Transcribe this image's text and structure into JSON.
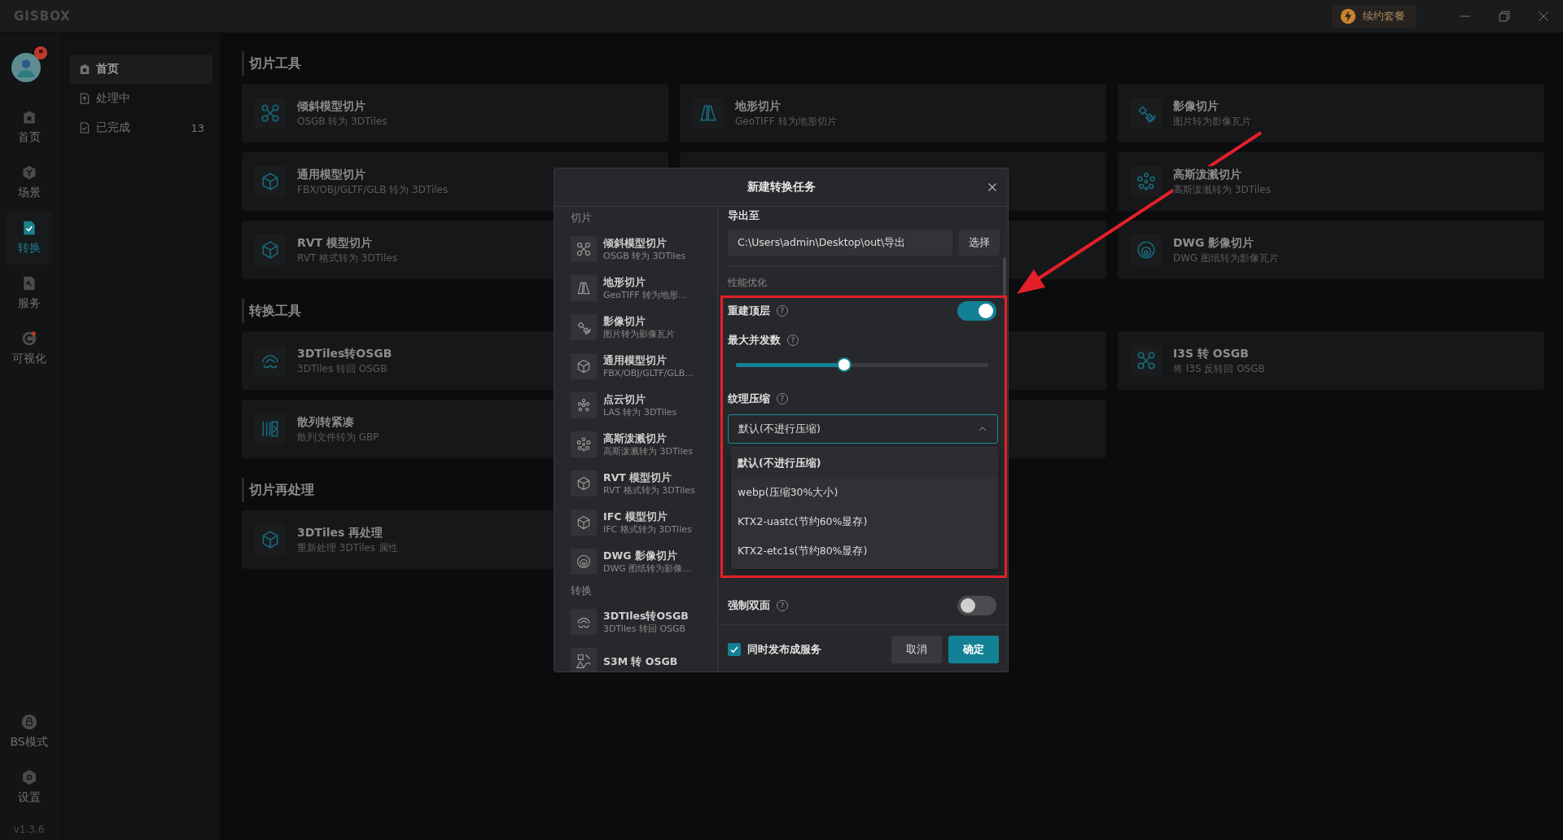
{
  "titlebar": {
    "logo": "GISBOX",
    "renew_button": "续约套餐"
  },
  "nav_rail": {
    "items": [
      {
        "label": "首页",
        "kind": "home",
        "selected": false
      },
      {
        "label": "场景",
        "kind": "scene",
        "selected": false
      },
      {
        "label": "转换",
        "kind": "convert",
        "selected": true
      },
      {
        "label": "服务",
        "kind": "service",
        "selected": false
      },
      {
        "label": "可视化",
        "kind": "visual",
        "selected": false
      }
    ],
    "bottom_items": [
      {
        "label": "BS模式",
        "kind": "lock"
      },
      {
        "label": "设置",
        "kind": "settings"
      }
    ],
    "version": "v1.3.6"
  },
  "task_menu": {
    "items": [
      {
        "label": "首页",
        "kind": "home",
        "selected": true
      },
      {
        "label": "处理中",
        "kind": "upload",
        "selected": false
      },
      {
        "label": "已完成",
        "kind": "done",
        "count": "13",
        "selected": false
      }
    ]
  },
  "sections": [
    {
      "title": "切片工具",
      "cards": [
        {
          "kind": "oblique",
          "title": "倾斜模型切片",
          "description": "OSGB 转为 3DTiles"
        },
        {
          "kind": "terrain",
          "title": "地形切片",
          "description": "GeoTIFF 转为地形切片"
        },
        {
          "kind": "imagery",
          "title": "影像切片",
          "description": "图片转为影像瓦片"
        },
        {
          "kind": "model",
          "title": "通用模型切片",
          "description": "FBX/OBJ/GLTF/GLB 转为 3DTiles"
        },
        {
          "kind": "covered"
        },
        {
          "kind": "gaussian",
          "title": "高斯泼溅切片",
          "description": "高斯泼溅转为 3DTiles"
        },
        {
          "kind": "model",
          "title": "RVT 模型切片",
          "description": "RVT 格式转为 3DTiles"
        },
        {
          "kind": "covered"
        },
        {
          "kind": "dwg",
          "title": "DWG 影像切片",
          "description": "DWG 图纸转为影像瓦片"
        }
      ]
    },
    {
      "title": "转换工具",
      "cards": [
        {
          "kind": "arches",
          "title": "3DTiles转OSGB",
          "description": "3DTiles 转回 OSGB"
        },
        {
          "kind": "covered"
        },
        {
          "kind": "oblique",
          "title": "I3S 转 OSGB",
          "description": "将 I3S 反转回 OSGB"
        },
        {
          "kind": "bars",
          "title": "散列转紧凑",
          "description": "散列文件转为 GBP"
        },
        {
          "kind": "covered"
        }
      ]
    },
    {
      "title": "切片再处理",
      "cards": [
        {
          "kind": "model",
          "title": "3DTiles 再处理",
          "description": "重新处理 3DTiles 属性"
        }
      ]
    }
  ],
  "dialog": {
    "title": "新建转换任务",
    "tool_groups": [
      {
        "heading": "切片",
        "items": [
          {
            "kind": "oblique",
            "title": "倾斜模型切片",
            "description": "OSGB 转为 3DTiles"
          },
          {
            "kind": "terrain",
            "title": "地形切片",
            "description": "GeoTIFF 转为地形…"
          },
          {
            "kind": "imagery",
            "title": "影像切片",
            "description": "图片转为影像瓦片"
          },
          {
            "kind": "model",
            "title": "通用模型切片",
            "description": "FBX/OBJ/GLTF/GLB…"
          },
          {
            "kind": "pointcloud",
            "title": "点云切片",
            "description": "LAS 转为 3DTiles"
          },
          {
            "kind": "gaussian",
            "title": "高斯泼溅切片",
            "description": "高斯泼溅转为 3DTiles"
          },
          {
            "kind": "model",
            "title": "RVT 模型切片",
            "description": "RVT 格式转为 3DTiles"
          },
          {
            "kind": "model",
            "title": "IFC 模型切片",
            "description": "IFC 格式转为 3DTiles"
          },
          {
            "kind": "dwg",
            "title": "DWG 影像切片",
            "description": "DWG 图纸转为影像…"
          }
        ]
      },
      {
        "heading": "转换",
        "items": [
          {
            "kind": "arches",
            "title": "3DTIles转OSGB",
            "description": "3DTiles 转回 OSGB"
          },
          {
            "kind": "shapes",
            "title": "S3M 转 OSGB"
          }
        ]
      }
    ],
    "export_label": "导出至",
    "export_path": "C:\\Users\\admin\\Desktop\\out\\导出",
    "choose_button": "选择",
    "section": "性能优化",
    "options": [
      {
        "kind": "toggle",
        "label": "重建顶层",
        "help": "?",
        "on": true
      },
      {
        "kind": "slider",
        "label": "最大并发数",
        "help": "?",
        "level": 0.43
      },
      {
        "kind": "select",
        "label": "纹理压缩",
        "help": "?",
        "value": "默认(不进行压缩)",
        "expanded": true,
        "choices": [
          {
            "label": "默认(不进行压缩)",
            "selected": true
          },
          {
            "label": "webp(压缩30%大小)",
            "selected": false
          },
          {
            "label": "KTX2-uastc(节约60%显存)",
            "selected": false
          },
          {
            "label": "KTX2-etc1s(节约80%显存)",
            "selected": false
          }
        ]
      },
      {
        "kind": "toggle",
        "label": "强制双面",
        "help": "?",
        "on": false
      }
    ],
    "publish": {
      "label": "同时发布成服务",
      "checked": true
    },
    "buttons": [
      {
        "kind": "secondary",
        "label": "取消"
      },
      {
        "kind": "primary",
        "label": "确定"
      }
    ]
  }
}
